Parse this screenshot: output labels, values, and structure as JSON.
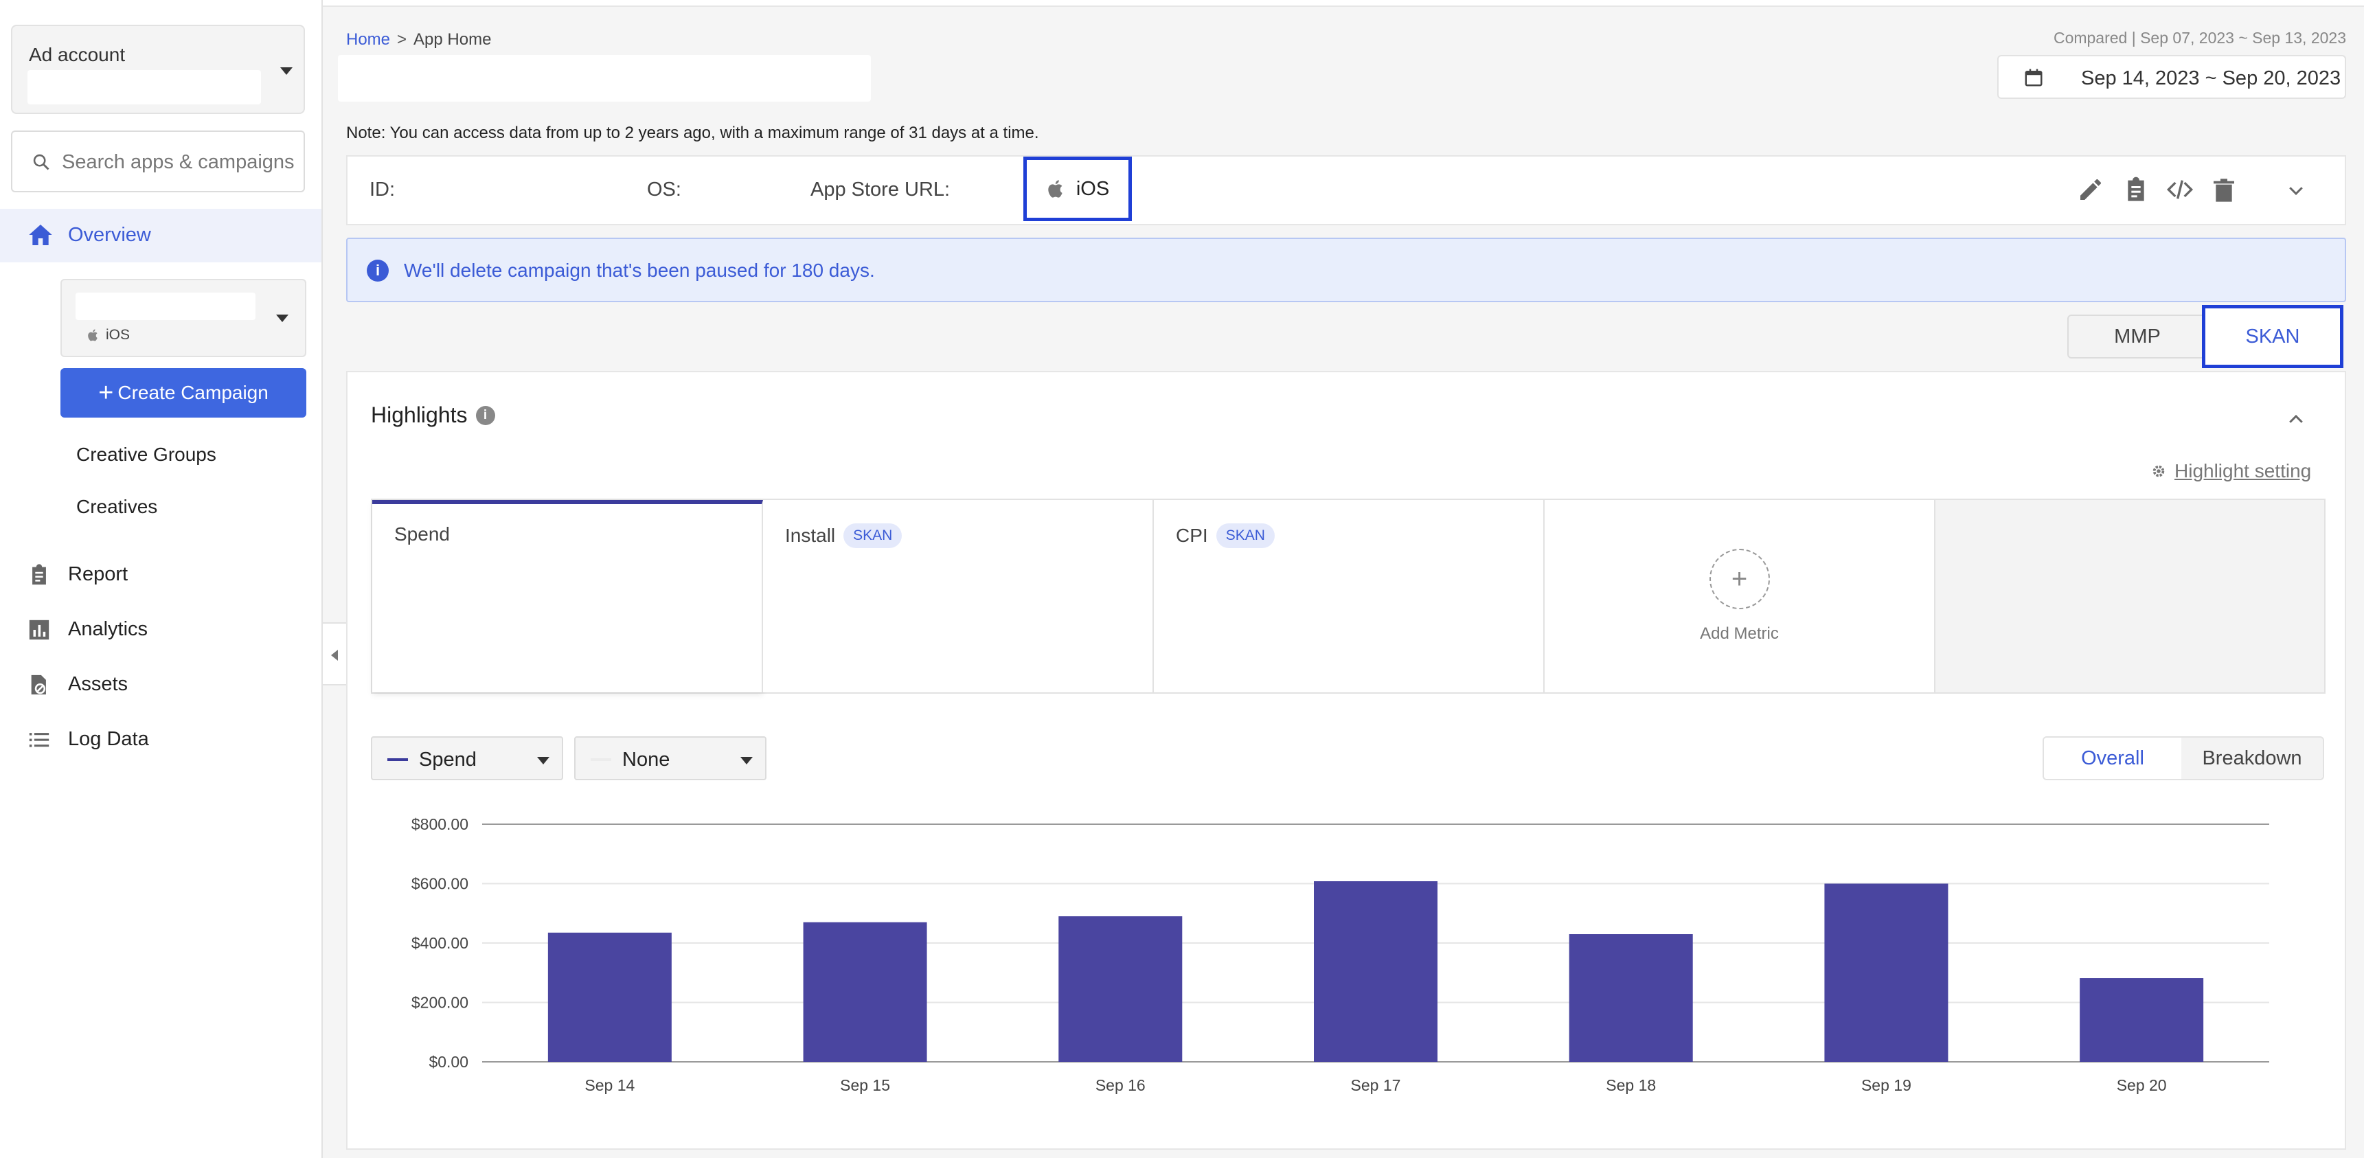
{
  "sidebar": {
    "account_label": "Ad account",
    "search_placeholder": "Search apps & campaigns",
    "overview": "Overview",
    "app_os": "iOS",
    "create_campaign": "Create Campaign",
    "sub_items": [
      "Creative Groups",
      "Creatives"
    ],
    "nav": [
      "Report",
      "Analytics",
      "Assets",
      "Log Data"
    ]
  },
  "header": {
    "breadcrumb_home": "Home",
    "breadcrumb_sep": ">",
    "breadcrumb_current": "App Home",
    "compared": "Compared | Sep 07, 2023 ~ Sep 13, 2023",
    "date_range": "Sep 14, 2023 ~ Sep 20, 2023",
    "note": "Note: You can access data from up to 2 years ago, with a maximum range of 31 days at a time."
  },
  "info": {
    "id_label": "ID:",
    "os_label": "OS:",
    "os_value": "iOS",
    "store_label": "App Store URL:"
  },
  "notice": "We'll delete campaign that's been paused for 180 days.",
  "attribution": {
    "mmp": "MMP",
    "skan": "SKAN"
  },
  "highlights": {
    "title": "Highlights",
    "setting": "Highlight setting",
    "metrics": [
      {
        "name": "Spend",
        "badge": ""
      },
      {
        "name": "Install",
        "badge": "SKAN"
      },
      {
        "name": "CPI",
        "badge": "SKAN"
      }
    ],
    "add_metric": "Add Metric",
    "primary_select": "Spend",
    "secondary_select": "None",
    "view_overall": "Overall",
    "view_breakdown": "Breakdown"
  },
  "colors": {
    "accent": "#3b5bd6",
    "bar": "#4a45a0",
    "highlight_box": "#1f3fd6"
  },
  "chart_data": {
    "type": "bar",
    "categories": [
      "Sep 14",
      "Sep 15",
      "Sep 16",
      "Sep 17",
      "Sep 18",
      "Sep 19",
      "Sep 20"
    ],
    "series": [
      {
        "name": "Spend",
        "values": [
          435,
          470,
          490,
          608,
          430,
          600,
          282
        ]
      }
    ],
    "ylim": [
      0,
      800
    ],
    "yticks": [
      "$0.00",
      "$200.00",
      "$400.00",
      "$600.00",
      "$800.00"
    ],
    "grid": true
  }
}
